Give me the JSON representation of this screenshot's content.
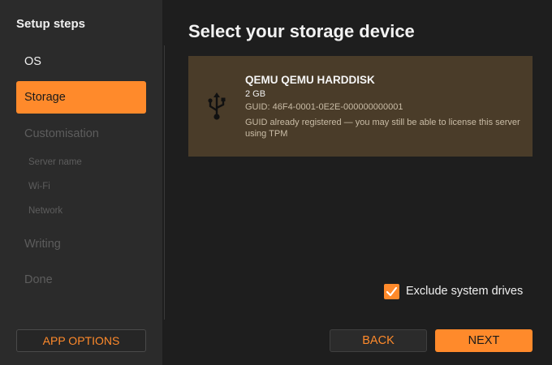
{
  "sidebar": {
    "title": "Setup steps",
    "steps": {
      "os": "OS",
      "storage": "Storage",
      "customisation": "Customisation",
      "server_name": "Server name",
      "wifi": "Wi-Fi",
      "network": "Network",
      "writing": "Writing",
      "done": "Done"
    },
    "app_options_label": "APP OPTIONS"
  },
  "main": {
    "title": "Select your storage device",
    "device": {
      "icon": "usb-icon",
      "name": "QEMU QEMU HARDDISK",
      "size": "2 GB",
      "guid": "GUID: 46F4-0001-0E2E-000000000001",
      "note": "GUID already registered — you may still be able to license this server using TPM"
    },
    "exclude_system_drives": {
      "label": "Exclude system drives",
      "checked": true
    },
    "buttons": {
      "back": "BACK",
      "next": "NEXT"
    }
  },
  "colors": {
    "accent": "#ff8a2b",
    "selected_card": "#4a3c29",
    "sidebar_bg": "#2b2b2b",
    "main_bg": "#1e1e1e"
  }
}
